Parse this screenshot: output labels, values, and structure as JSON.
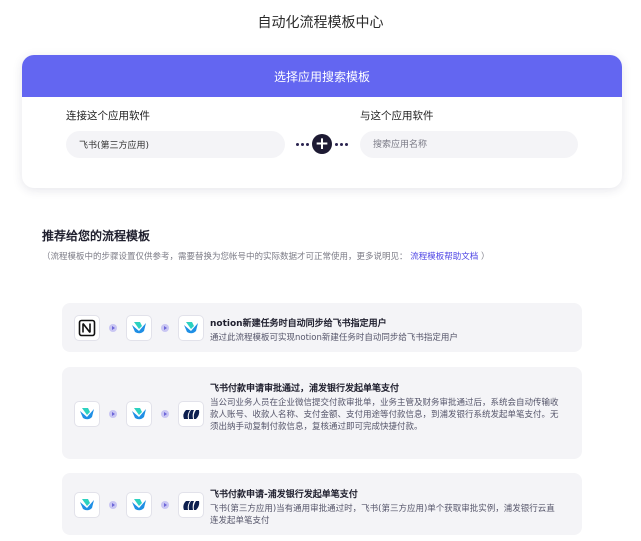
{
  "page": {
    "title": "自动化流程模板中心"
  },
  "search_card": {
    "header": "选择应用搜索模板",
    "left_label": "连接这个应用软件",
    "left_value": "飞书(第三方应用)",
    "right_label": "与这个应用软件",
    "right_placeholder": "搜索应用名称"
  },
  "recommend": {
    "title": "推荐给您的流程模板",
    "note": "（流程模板中的步骤设置仅供参考，需要替换为您帐号中的实际数据才可正常使用，更多说明见：",
    "help_link": "流程模板帮助文档",
    "note_end": "）"
  },
  "templates": [
    {
      "title": "notion新建任务时自动同步给飞书指定用户",
      "desc": "通过此流程模板可实现notion新建任务时自动同步给飞书指定用户",
      "icons": [
        "notion-icon",
        "feishu-icon",
        "feishu-icon"
      ]
    },
    {
      "title": "飞书付款申请审批通过，浦发银行发起单笔支付",
      "desc": "当公司业务人员在企业微信提交付款审批单，业务主管及财务审批通过后，系统会自动传输收款人账号、收款人名称、支付金额、支付用途等付款信息，到浦发银行系统发起单笔支付。无须出纳手动复制付款信息，复核通过即可完成快捷付款。",
      "icons": [
        "feishu-icon",
        "feishu-icon",
        "spdb-icon"
      ]
    },
    {
      "title": "飞书付款申请-浦发银行发起单笔支付",
      "desc": "飞书(第三方应用)当有通用审批通过时，飞书(第三方应用)单个获取审批实例，浦发银行云直连发起单笔支付",
      "icons": [
        "feishu-icon",
        "feishu-icon",
        "spdb-icon"
      ]
    }
  ],
  "colors": {
    "accent": "#6366f1",
    "card_bg": "#f4f4f7"
  }
}
